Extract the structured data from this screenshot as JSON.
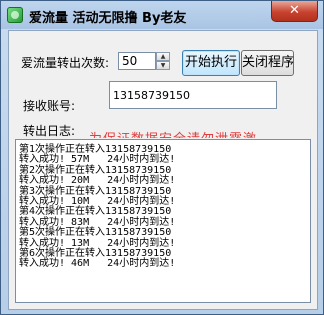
{
  "window": {
    "title": "爱流量 活动无限撸 By老友",
    "close_label": "✕"
  },
  "form": {
    "count_label": "爱流量转出次数:",
    "count_value": "50",
    "spin_up": "▲",
    "spin_down": "▼",
    "start_button": "开始执行",
    "close_button": "关闭程序",
    "account_label": "接收账号:",
    "account_value": "13158739150",
    "log_label": "转出日志:",
    "overlay_text": "为保证数据安全请勿泄露激活码"
  },
  "log": [
    "第1次操作正在转入13158739150",
    "转入成功! 57M   24小时内到达!",
    "第2次操作正在转入13158739150",
    "转入成功! 20M   24小时内到达!",
    "第3次操作正在转入13158739150",
    "转入成功! 10M   24小时内到达!",
    "第4次操作正在转入13158739150",
    "转入成功! 83M   24小时内到达!",
    "第5次操作正在转入13158739150",
    "转入成功! 13M   24小时内到达!",
    "第6次操作正在转入13158739150",
    "转入成功! 46M   24小时内到达!"
  ]
}
